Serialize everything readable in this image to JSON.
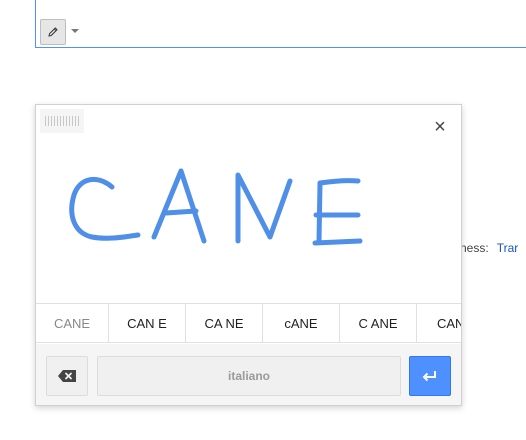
{
  "toolbar": {
    "tool_icon": "pencil-icon",
    "dropdown_icon": "caret-down-icon"
  },
  "background": {
    "text": "ness:",
    "link": "Trar"
  },
  "panel": {
    "close_label": "×",
    "handwriting_ink_color": "#4f8fe8",
    "candidates": [
      "CANE",
      "CAN E",
      "CA NE",
      "cANE",
      "C ANE",
      "CANE"
    ],
    "language_label": "italiano",
    "accent_color": "#4d90fe"
  }
}
